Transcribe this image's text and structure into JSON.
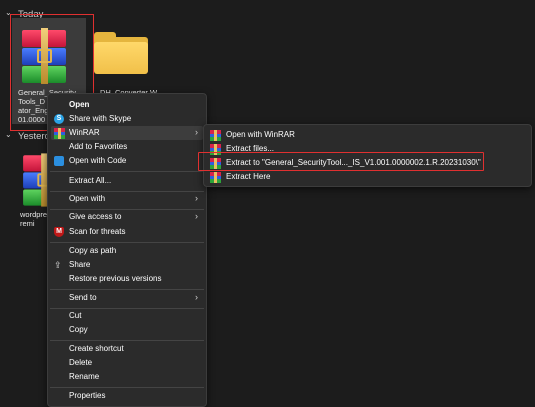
{
  "groups": {
    "today_label": "Today",
    "yesterday_label": "Yesterd"
  },
  "files": {
    "selected_file": "General_Security\nTools_D\nator_Eng\n01.0000",
    "folder": "DH_Converter W",
    "yesterday_file": "wordpre\nremi"
  },
  "context_menu": {
    "items": [
      {
        "label": "Open",
        "icon": "none"
      },
      {
        "label": "Share with Skype",
        "icon": "skype-icon"
      },
      {
        "label": "WinRAR",
        "icon": "winrar-icon"
      },
      {
        "label": "Add to Favorites",
        "icon": "none"
      },
      {
        "label": "Open with Code",
        "icon": "vscode-icon"
      },
      {
        "label": "Extract All...",
        "icon": "none"
      },
      {
        "label": "Open with",
        "icon": "none"
      },
      {
        "label": "Give access to",
        "icon": "none"
      },
      {
        "label": "Scan for threats",
        "icon": "mcafee-icon"
      },
      {
        "label": "Copy as path",
        "icon": "none"
      },
      {
        "label": "Share",
        "icon": "share-icon"
      },
      {
        "label": "Restore previous versions",
        "icon": "none"
      },
      {
        "label": "Send to",
        "icon": "none"
      },
      {
        "label": "Cut",
        "icon": "none"
      },
      {
        "label": "Copy",
        "icon": "none"
      },
      {
        "label": "Create shortcut",
        "icon": "none"
      },
      {
        "label": "Delete",
        "icon": "none"
      },
      {
        "label": "Rename",
        "icon": "none"
      },
      {
        "label": "Properties",
        "icon": "none"
      }
    ]
  },
  "winrar_submenu": {
    "items": [
      {
        "label": "Open with WinRAR"
      },
      {
        "label": "Extract files..."
      },
      {
        "label": "Extract to \"General_SecurityTool..._IS_V1.001.0000002.1.R.20231030\\\""
      },
      {
        "label": "Extract Here"
      }
    ]
  },
  "colors": {
    "background": "#1c1c1c",
    "menu": "#2b2b2b",
    "annotation_red": "#e03030"
  }
}
